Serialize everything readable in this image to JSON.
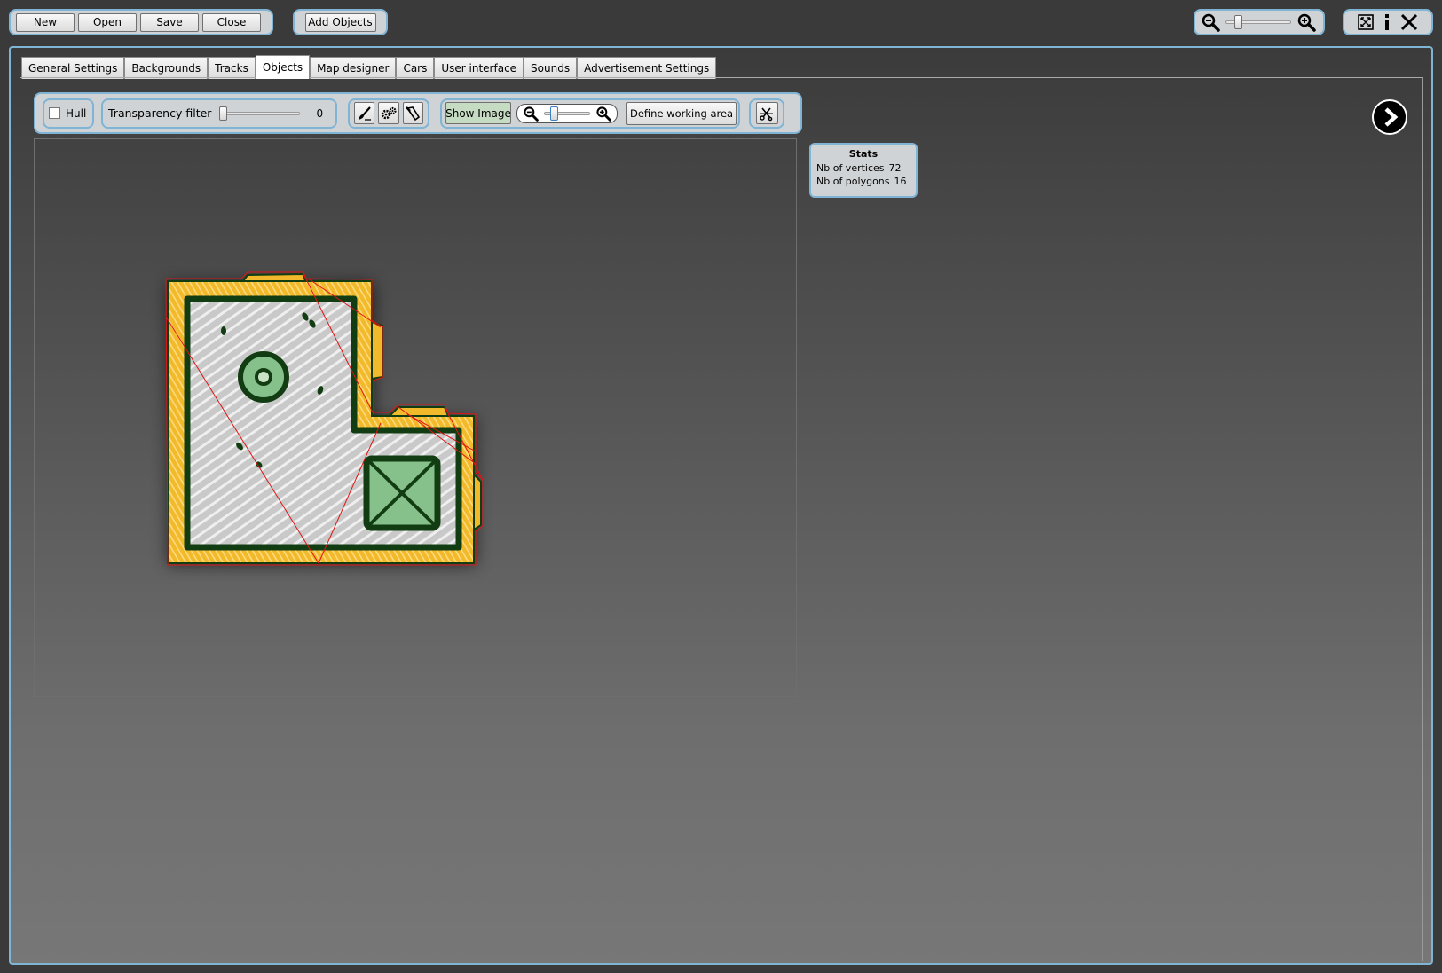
{
  "toolbar": {
    "new_label": "New",
    "open_label": "Open",
    "save_label": "Save",
    "close_label": "Close",
    "add_objects_label": "Add Objects"
  },
  "window_controls": {
    "zoom_slider_value": 0.15,
    "icons": [
      "zoom-out-icon",
      "zoom-in-icon",
      "fullscreen-icon",
      "info-icon",
      "close-icon"
    ]
  },
  "tabs": [
    {
      "label": "General Settings",
      "active": false
    },
    {
      "label": "Backgrounds",
      "active": false
    },
    {
      "label": "Tracks",
      "active": false
    },
    {
      "label": "Objects",
      "active": true
    },
    {
      "label": "Map designer",
      "active": false
    },
    {
      "label": "Cars",
      "active": false
    },
    {
      "label": "User interface",
      "active": false
    },
    {
      "label": "Sounds",
      "active": false
    },
    {
      "label": "Advertisement Settings",
      "active": false
    }
  ],
  "object_toolbar": {
    "hull_label": "Hull",
    "hull_checked": false,
    "transparency_label": "Transparency filter",
    "transparency_value": "0",
    "show_image_label": "Show Image",
    "image_zoom_value": 0.15,
    "define_area_label": "Define working area",
    "tool_icons": [
      "brush-tool-icon",
      "gears-icon",
      "eraser-icon",
      "scissors-icon"
    ]
  },
  "stats": {
    "title": "Stats",
    "vertices_label": "Nb of vertices",
    "vertices_value": "72",
    "polygons_label": "Nb of polygons",
    "polygons_value": "16"
  },
  "colors": {
    "frame_border": "#7fb4d4",
    "object_outline": "#123d12",
    "object_fill_yellow": "#f2b92b",
    "object_fill_grey": "#c9c9c9",
    "object_accent_green": "#86c08a",
    "polygon_lines": "#e01414",
    "show_image_active": "#c6dcc2"
  }
}
